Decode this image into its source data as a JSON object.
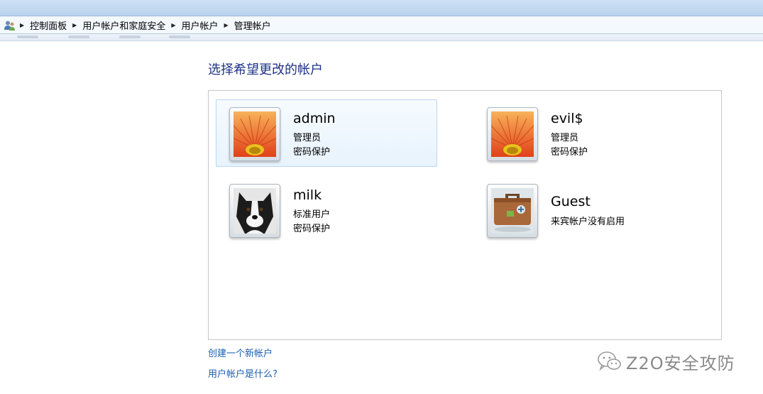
{
  "breadcrumb": {
    "items": [
      "控制面板",
      "用户帐户和家庭安全",
      "用户帐户",
      "管理帐户"
    ]
  },
  "page": {
    "heading": "选择希望更改的帐户"
  },
  "accounts": [
    {
      "name": "admin",
      "type": "管理员",
      "status": "密码保护",
      "picture": "orange-flower-picture",
      "selected": true
    },
    {
      "name": "evil$",
      "type": "管理员",
      "status": "密码保护",
      "picture": "orange-flower-picture",
      "selected": false
    },
    {
      "name": "milk",
      "type": "标准用户",
      "status": "密码保护",
      "picture": "dog-picture",
      "selected": false
    },
    {
      "name": "Guest",
      "type": "来宾帐户没有启用",
      "status": "",
      "picture": "suitcase-picture",
      "selected": false
    }
  ],
  "links": {
    "create_account": "创建一个新帐户",
    "what_is_account": "用户帐户是什么?"
  },
  "watermark": {
    "text": "Z2O安全攻防"
  },
  "colors": {
    "heading": "#1e3287",
    "link": "#1b5fb0",
    "selection_bg": "#e8f3fd",
    "selection_border": "#b9d7f0"
  }
}
